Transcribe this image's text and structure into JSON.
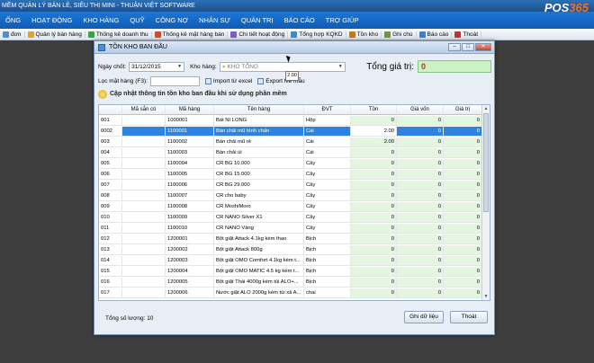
{
  "app": {
    "title": "MỀM QUẢN LÝ BÁN LẺ, SIÊU THỊ MINI - THUẬN VIỆT SOFTWARE"
  },
  "menu": [
    "ỐNG",
    "HOẠT ĐỘNG",
    "KHO HÀNG",
    "QUỸ",
    "CÔNG NỢ",
    "NHÂN SỰ",
    "QUẢN TRỊ",
    "BÁO CÁO",
    "TRỢ GIÚP"
  ],
  "logo": {
    "text": "POS",
    "num": "365"
  },
  "quickbar": [
    "đơn",
    "Quản lý bán hàng",
    "Thống kê doanh thu",
    "Thống kê mặt hàng bán",
    "Chi tiết hoạt động",
    "Tổng hợp KQKD",
    "Tồn kho",
    "Ghi chú",
    "Báo cáo",
    "Thoát"
  ],
  "quickbar_colors": [
    "#4a8fd8",
    "#e0a520",
    "#3aa04a",
    "#d04a30",
    "#7a5fc0",
    "#2f8fd0",
    "#c07a20",
    "#6a9a30",
    "#3f7fc8",
    "#c83030"
  ],
  "dialog": {
    "title": "TỒN KHO BAN ĐẦU",
    "date_label": "Ngày chốt:",
    "date_value": "31/12/2015",
    "warehouse_label": "Kho hàng:",
    "warehouse_value": "KHO TỔNG",
    "total_label": "Tổng giá trị:",
    "total_value": "0",
    "search_label": "Lọc mặt hàng (F3):",
    "import_label": "Import từ excel",
    "export_label": "Export file mẫu",
    "banner": "Cập nhật thông tin tồn kho ban đầu khi sử dụng phần mềm",
    "count_label": "Tổng số lượng: 10",
    "save_label": "Ghi dữ liệu",
    "exit_label": "Thoát",
    "dropdown_value": "2.00"
  },
  "grid": {
    "headers": {
      "stt": "",
      "sc": "Mã sắn có",
      "mh": "Mã hàng",
      "th": "Tên hàng",
      "dvt": "ĐVT",
      "ton": "Tồn",
      "gv": "Giá vốn",
      "gt": "Giá trị"
    },
    "rows": [
      {
        "stt": "001",
        "mh": "1000001",
        "th": "Bát NI LONG",
        "dvt": "Hộp",
        "ton": "0",
        "gv": "0",
        "gt": "0"
      },
      {
        "stt": "0002",
        "mh": "1100001",
        "th": "Bàn chải mũ hình chấn",
        "dvt": "Cái",
        "ton": "2.00",
        "gv": "0",
        "gt": "0"
      },
      {
        "stt": "003",
        "mh": "1100002",
        "th": "Bàn chải mũ rẻ",
        "dvt": "Cái",
        "ton": "2.00",
        "gv": "0",
        "gt": "0"
      },
      {
        "stt": "004",
        "mh": "1100003",
        "th": "Bàn chải úi",
        "dvt": "Cái",
        "ton": "0",
        "gv": "0",
        "gt": "0"
      },
      {
        "stt": "005",
        "mh": "1100004",
        "th": "CR BG 10.000",
        "dvt": "Cây",
        "ton": "0",
        "gv": "0",
        "gt": "0"
      },
      {
        "stt": "006",
        "mh": "1100005",
        "th": "CR BG 15.000",
        "dvt": "Cây",
        "ton": "0",
        "gv": "0",
        "gt": "0"
      },
      {
        "stt": "007",
        "mh": "1100006",
        "th": "CR BG 29.000",
        "dvt": "Cây",
        "ton": "0",
        "gv": "0",
        "gt": "0"
      },
      {
        "stt": "008",
        "mh": "1100007",
        "th": "CR cho baby",
        "dvt": "Cây",
        "ton": "0",
        "gv": "0",
        "gt": "0"
      },
      {
        "stt": "009",
        "mh": "1100008",
        "th": "CR MoshiMoro",
        "dvt": "Cây",
        "ton": "0",
        "gv": "0",
        "gt": "0"
      },
      {
        "stt": "010",
        "mh": "1100009",
        "th": "CR NANO Silver X1",
        "dvt": "Cây",
        "ton": "0",
        "gv": "0",
        "gt": "0"
      },
      {
        "stt": "011",
        "mh": "1100010",
        "th": "CR NANO Vàng",
        "dvt": "Cây",
        "ton": "0",
        "gv": "0",
        "gt": "0"
      },
      {
        "stt": "012",
        "mh": "1200001",
        "th": "Bột giặt Attack 4.1kg kèm thao",
        "dvt": "Bịch",
        "ton": "0",
        "gv": "0",
        "gt": "0"
      },
      {
        "stt": "013",
        "mh": "1200002",
        "th": "Bột giặt Attack 800g",
        "dvt": "Bịch",
        "ton": "0",
        "gv": "0",
        "gt": "0"
      },
      {
        "stt": "014",
        "mh": "1200003",
        "th": "Bột giặt OMO Comfort 4.1kg kèm t...",
        "dvt": "Bịch",
        "ton": "0",
        "gv": "0",
        "gt": "0"
      },
      {
        "stt": "015",
        "mh": "1200004",
        "th": "Bột giặt OMO MATIC 4.5 kg kèm t...",
        "dvt": "Bịch",
        "ton": "0",
        "gv": "0",
        "gt": "0"
      },
      {
        "stt": "016",
        "mh": "1200005",
        "th": "Bột giặt Thái 4000g kèm túi ALO+...",
        "dvt": "Bịch",
        "ton": "0",
        "gv": "0",
        "gt": "0"
      },
      {
        "stt": "017",
        "mh": "1200006",
        "th": "Nước giặt ALO 2000g kèm túi xả A...",
        "dvt": "chai",
        "ton": "0",
        "gv": "0",
        "gt": "0"
      }
    ]
  }
}
